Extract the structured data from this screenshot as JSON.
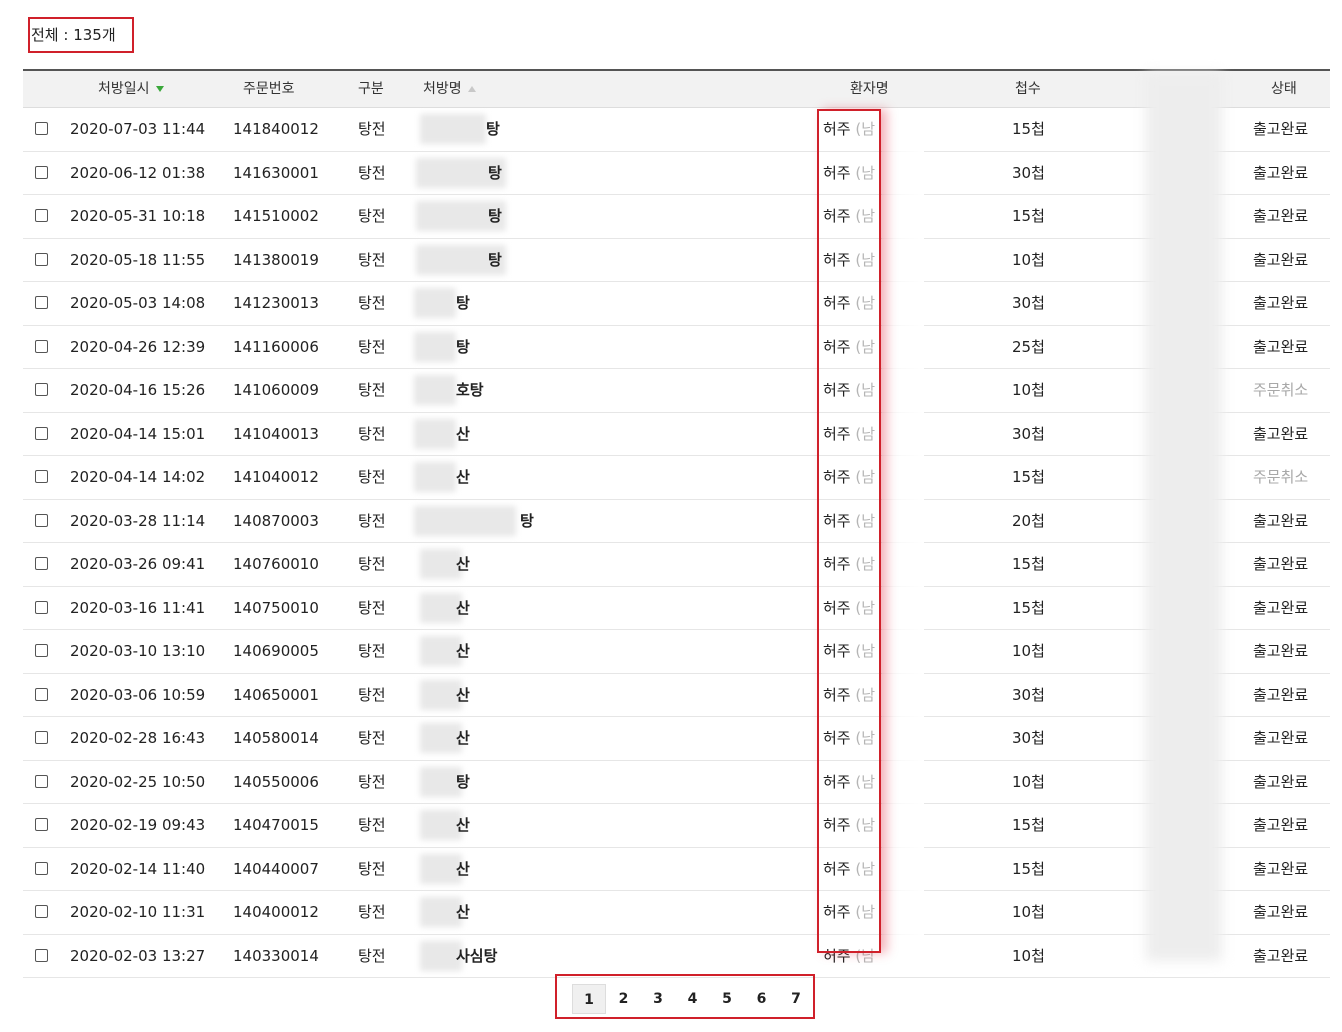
{
  "total_label": "전체 : 135개",
  "headers": {
    "date": "처방일시",
    "order_no": "주문번호",
    "type": "구분",
    "prescription": "처방명",
    "patient": "환자명",
    "chupsu": "첩수",
    "status": "상태"
  },
  "rows": [
    {
      "date": "2020-07-03 11:44",
      "order_no": "141840012",
      "type": "탕전",
      "prescription": "탕",
      "patient": "허주",
      "gender": "(남",
      "chupsu": "15첩",
      "status": "출고완료"
    },
    {
      "date": "2020-06-12 01:38",
      "order_no": "141630001",
      "type": "탕전",
      "prescription": "탕",
      "patient": "허주",
      "gender": "(남",
      "chupsu": "30첩",
      "status": "출고완료"
    },
    {
      "date": "2020-05-31 10:18",
      "order_no": "141510002",
      "type": "탕전",
      "prescription": "탕",
      "patient": "허주",
      "gender": "(남",
      "chupsu": "15첩",
      "status": "출고완료"
    },
    {
      "date": "2020-05-18 11:55",
      "order_no": "141380019",
      "type": "탕전",
      "prescription": "탕",
      "patient": "허주",
      "gender": "(남",
      "chupsu": "10첩",
      "status": "출고완료"
    },
    {
      "date": "2020-05-03 14:08",
      "order_no": "141230013",
      "type": "탕전",
      "prescription": "탕",
      "patient": "허주",
      "gender": "(남",
      "chupsu": "30첩",
      "status": "출고완료"
    },
    {
      "date": "2020-04-26 12:39",
      "order_no": "141160006",
      "type": "탕전",
      "prescription": "탕",
      "patient": "허주",
      "gender": "(남",
      "chupsu": "25첩",
      "status": "출고완료"
    },
    {
      "date": "2020-04-16 15:26",
      "order_no": "141060009",
      "type": "탕전",
      "prescription": "호탕",
      "patient": "허주",
      "gender": "(남",
      "chupsu": "10첩",
      "status": "주문취소"
    },
    {
      "date": "2020-04-14 15:01",
      "order_no": "141040013",
      "type": "탕전",
      "prescription": "산",
      "patient": "허주",
      "gender": "(남",
      "chupsu": "30첩",
      "status": "출고완료"
    },
    {
      "date": "2020-04-14 14:02",
      "order_no": "141040012",
      "type": "탕전",
      "prescription": "산",
      "patient": "허주",
      "gender": "(남",
      "chupsu": "15첩",
      "status": "주문취소"
    },
    {
      "date": "2020-03-28 11:14",
      "order_no": "140870003",
      "type": "탕전",
      "prescription": "탕",
      "patient": "허주",
      "gender": "(남",
      "chupsu": "20첩",
      "status": "출고완료"
    },
    {
      "date": "2020-03-26 09:41",
      "order_no": "140760010",
      "type": "탕전",
      "prescription": "산",
      "patient": "허주",
      "gender": "(남",
      "chupsu": "15첩",
      "status": "출고완료"
    },
    {
      "date": "2020-03-16 11:41",
      "order_no": "140750010",
      "type": "탕전",
      "prescription": "산",
      "patient": "허주",
      "gender": "(남",
      "chupsu": "15첩",
      "status": "출고완료"
    },
    {
      "date": "2020-03-10 13:10",
      "order_no": "140690005",
      "type": "탕전",
      "prescription": "산",
      "patient": "허주",
      "gender": "(남",
      "chupsu": "10첩",
      "status": "출고완료"
    },
    {
      "date": "2020-03-06 10:59",
      "order_no": "140650001",
      "type": "탕전",
      "prescription": "산",
      "patient": "허주",
      "gender": "(남",
      "chupsu": "30첩",
      "status": "출고완료"
    },
    {
      "date": "2020-02-28 16:43",
      "order_no": "140580014",
      "type": "탕전",
      "prescription": "산",
      "patient": "허주",
      "gender": "(남",
      "chupsu": "30첩",
      "status": "출고완료"
    },
    {
      "date": "2020-02-25 10:50",
      "order_no": "140550006",
      "type": "탕전",
      "prescription": "탕",
      "patient": "허주",
      "gender": "(남",
      "chupsu": "10첩",
      "status": "출고완료"
    },
    {
      "date": "2020-02-19 09:43",
      "order_no": "140470015",
      "type": "탕전",
      "prescription": "산",
      "patient": "허주",
      "gender": "(남",
      "chupsu": "15첩",
      "status": "출고완료"
    },
    {
      "date": "2020-02-14 11:40",
      "order_no": "140440007",
      "type": "탕전",
      "prescription": "산",
      "patient": "허주",
      "gender": "(남",
      "chupsu": "15첩",
      "status": "출고완료"
    },
    {
      "date": "2020-02-10 11:31",
      "order_no": "140400012",
      "type": "탕전",
      "prescription": "산",
      "patient": "허주",
      "gender": "(남",
      "chupsu": "10첩",
      "status": "출고완료"
    },
    {
      "date": "2020-02-03 13:27",
      "order_no": "140330014",
      "type": "탕전",
      "prescription": "사심탕",
      "patient": "허주",
      "gender": "(남",
      "chupsu": "10첩",
      "status": "출고완료"
    }
  ],
  "pagination": [
    "1",
    "2",
    "3",
    "4",
    "5",
    "6",
    "7"
  ],
  "current_page": "1"
}
